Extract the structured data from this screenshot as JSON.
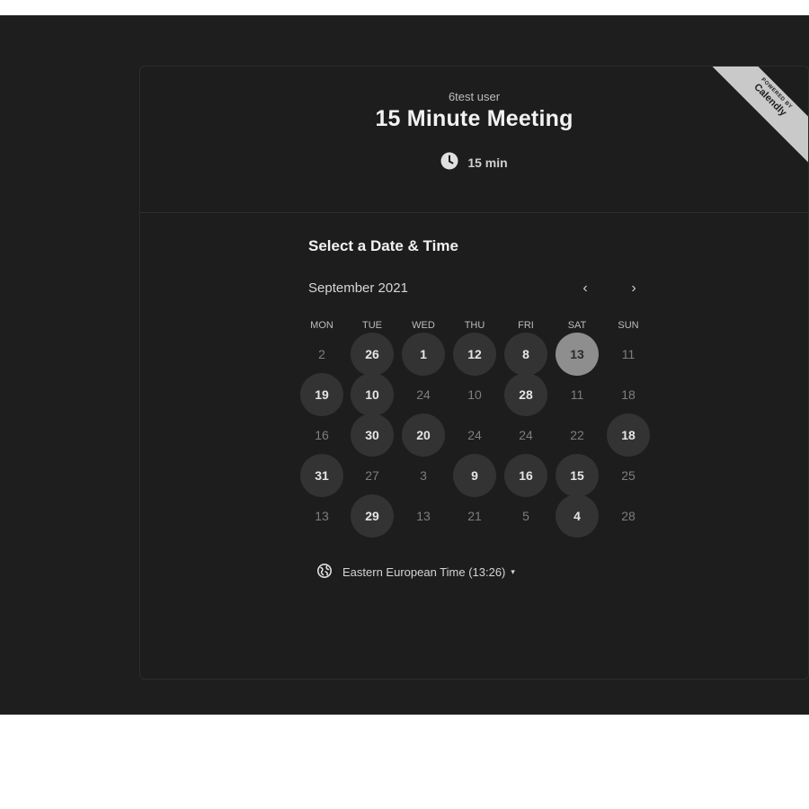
{
  "event": {
    "owner": "6test user",
    "title": "15 Minute Meeting",
    "duration": "15 min"
  },
  "ribbon": {
    "small": "POWERED BY",
    "brand": "Calendly"
  },
  "calendar": {
    "heading": "Select a Date & Time",
    "month": "September 2021",
    "prev_icon": "chevron-left-icon",
    "next_icon": "chevron-right-icon",
    "weekdays": [
      "MON",
      "TUE",
      "WED",
      "THU",
      "FRI",
      "SAT",
      "SUN"
    ],
    "weeks": [
      [
        {
          "d": "2",
          "s": "muted"
        },
        {
          "d": "26",
          "s": "avail"
        },
        {
          "d": "1",
          "s": "avail"
        },
        {
          "d": "12",
          "s": "avail"
        },
        {
          "d": "8",
          "s": "avail"
        },
        {
          "d": "13",
          "s": "selected"
        },
        {
          "d": "11",
          "s": "muted"
        }
      ],
      [
        {
          "d": "19",
          "s": "avail"
        },
        {
          "d": "10",
          "s": "avail"
        },
        {
          "d": "24",
          "s": "muted"
        },
        {
          "d": "10",
          "s": "muted"
        },
        {
          "d": "28",
          "s": "avail"
        },
        {
          "d": "11",
          "s": "muted"
        },
        {
          "d": "18",
          "s": "muted"
        }
      ],
      [
        {
          "d": "16",
          "s": "muted"
        },
        {
          "d": "30",
          "s": "avail"
        },
        {
          "d": "20",
          "s": "avail"
        },
        {
          "d": "24",
          "s": "muted"
        },
        {
          "d": "24",
          "s": "muted"
        },
        {
          "d": "22",
          "s": "muted"
        },
        {
          "d": "18",
          "s": "avail"
        }
      ],
      [
        {
          "d": "31",
          "s": "avail"
        },
        {
          "d": "27",
          "s": "muted"
        },
        {
          "d": "3",
          "s": "muted"
        },
        {
          "d": "9",
          "s": "avail"
        },
        {
          "d": "16",
          "s": "avail"
        },
        {
          "d": "15",
          "s": "avail"
        },
        {
          "d": "25",
          "s": "muted"
        }
      ],
      [
        {
          "d": "13",
          "s": "muted"
        },
        {
          "d": "29",
          "s": "avail"
        },
        {
          "d": "13",
          "s": "muted"
        },
        {
          "d": "21",
          "s": "muted"
        },
        {
          "d": "5",
          "s": "muted"
        },
        {
          "d": "4",
          "s": "avail"
        },
        {
          "d": "28",
          "s": "muted"
        }
      ]
    ]
  },
  "timezone": {
    "label": "Eastern European Time (13:26)",
    "icon": "globe-icon",
    "caret": "▾"
  },
  "colors": {
    "background": "#1e1e1e",
    "card": "#1d1d1d",
    "available_day": "#333333",
    "selected_day": "#8e8e8e"
  }
}
